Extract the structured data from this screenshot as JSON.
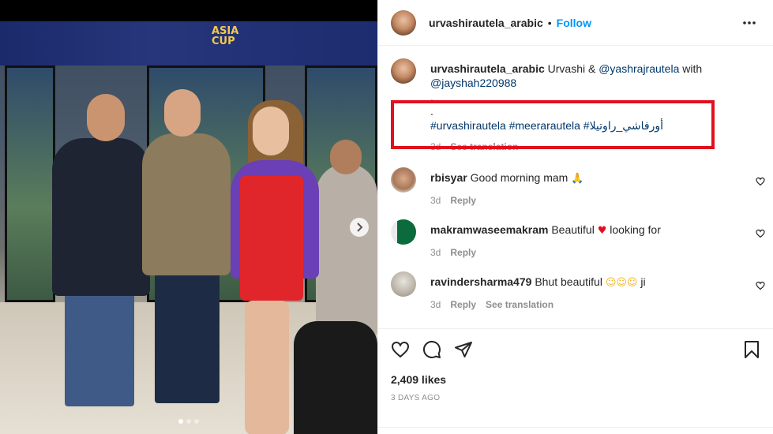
{
  "post": {
    "username": "urvashirautela_arabic",
    "follow_label": "Follow",
    "separator": "•",
    "caption": {
      "username": "urvashirautela_arabic",
      "text_before": "Urvashi & ",
      "mention1": "@yashrajrautela",
      "text_mid": " with",
      "mention2": "@jayshah220988",
      "line3": ".",
      "line4": ".",
      "hashtags": "#urvashirautela #meerarautela #أورفاشي_راوتيلا",
      "age": "3d",
      "see_translation": "See translation"
    },
    "comments": [
      {
        "username": "rbisyar",
        "text": "Good morning mam",
        "age": "3d",
        "reply": "Reply",
        "emoji": "pray-emoji"
      },
      {
        "username": "makramwaseemakram",
        "text_before": "Beautiful",
        "text_after": "looking for",
        "age": "3d",
        "reply": "Reply",
        "emoji": "red-heart-emoji"
      },
      {
        "username": "ravindersharma479",
        "text_before": "Bhut beautiful",
        "text_after": "ji",
        "age": "3d",
        "reply": "Reply",
        "see_translation": "See translation",
        "emoji": "smiling-face-with-hearts-emoji"
      }
    ],
    "likes": "2,409 likes",
    "time": "3 DAYS AGO"
  },
  "image": {
    "banner_text": "ASIA\nCUP",
    "carousel_dots": 3,
    "active_dot": 1
  },
  "colors": {
    "follow": "#0095f6",
    "mention": "#00376b",
    "highlight": "#e0101e",
    "meta": "#8e8e8e"
  }
}
